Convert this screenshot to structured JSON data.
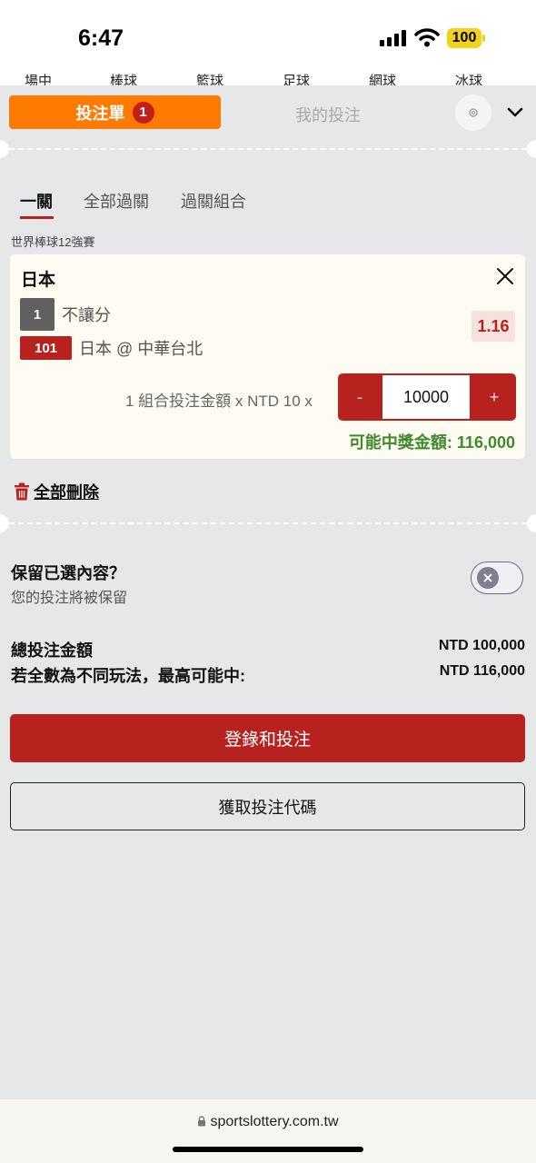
{
  "status": {
    "time": "6:47",
    "battery": "100"
  },
  "sports_tabs": [
    "場中",
    "棒球",
    "籃球",
    "足球",
    "網球",
    "冰球"
  ],
  "header": {
    "betslip_label": "投注單",
    "betslip_count": "1",
    "mybets_label": "我的投注"
  },
  "subtabs": [
    "一關",
    "全部過關",
    "過關組合"
  ],
  "league": "世界棒球12強賽",
  "selection": {
    "team": "日本",
    "market_code": "1",
    "market_name": "不讓分",
    "match_code": "101",
    "match_name": "日本 @ 中華台北",
    "odds": "1.16",
    "stake_text": "1 組合投注金額 x NTD 10 x",
    "stake_minus": "-",
    "stake_value": "10000",
    "stake_plus": "+",
    "possible_win": "可能中獎金額: 116,000"
  },
  "delete_all": "全部刪除",
  "keep": {
    "title": "保留已選內容？",
    "subtitle": "您的投注將被保留"
  },
  "summary": {
    "total_label": "總投注金額",
    "total_value": "NTD 100,000",
    "max_label": "若全數為不同玩法，最高可能中:",
    "max_value": "NTD 116,000"
  },
  "buttons": {
    "login": "登錄和投注",
    "code": "獲取投注代碼"
  },
  "browser": {
    "url": "sportslottery.com.tw"
  },
  "colors": {
    "primary_red": "#b8221e",
    "orange": "#ff7a00",
    "win_green": "#3f8a2c"
  }
}
